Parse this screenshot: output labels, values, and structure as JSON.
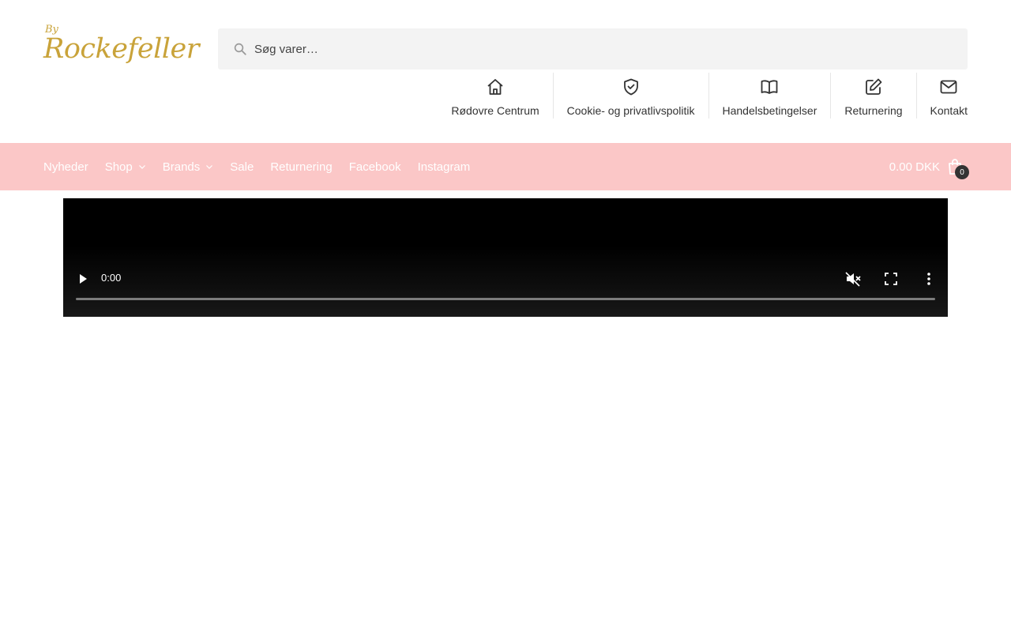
{
  "logo": {
    "by_text": "By",
    "name_text": "Rockefeller"
  },
  "search": {
    "placeholder": "Søg varer…",
    "value": ""
  },
  "quick_links": [
    {
      "label": "Rødovre Centrum",
      "icon": "home-icon"
    },
    {
      "label": "Cookie- og privatlivspolitik",
      "icon": "shield-check-icon"
    },
    {
      "label": "Handelsbetingelser",
      "icon": "book-open-icon"
    },
    {
      "label": "Returnering",
      "icon": "pencil-square-icon"
    },
    {
      "label": "Kontakt",
      "icon": "mail-icon"
    }
  ],
  "nav": {
    "items": [
      {
        "label": "Nyheder",
        "has_dropdown": false
      },
      {
        "label": "Shop",
        "has_dropdown": true
      },
      {
        "label": "Brands",
        "has_dropdown": true
      },
      {
        "label": "Sale",
        "has_dropdown": false
      },
      {
        "label": "Returnering",
        "has_dropdown": false
      },
      {
        "label": "Facebook",
        "has_dropdown": false
      },
      {
        "label": "Instagram",
        "has_dropdown": false
      }
    ],
    "cart_amount": "0.00 DKK",
    "cart_count": "0"
  },
  "video": {
    "time": "0:00",
    "progress": 0
  },
  "colors": {
    "navbar_bg": "#fbc7c7",
    "logo_gold": "#c9a33a",
    "search_bg": "#f3f3f3"
  }
}
